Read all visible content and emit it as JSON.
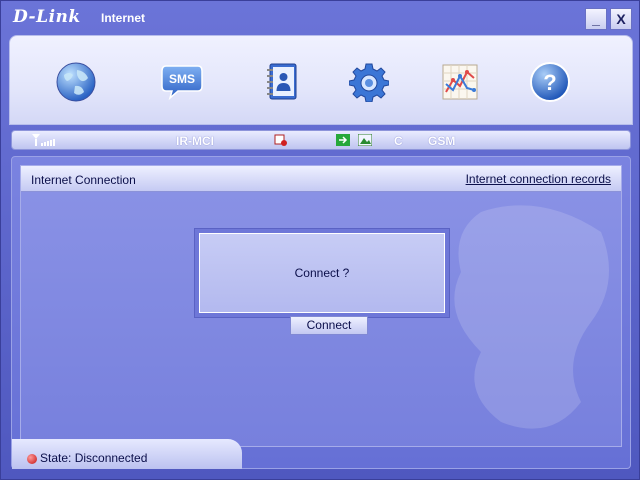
{
  "window": {
    "brand": "D-Link",
    "title": "Internet",
    "minimize_label": "_",
    "close_label": "X"
  },
  "toolbar": {
    "items": [
      {
        "name": "internet",
        "icon": "globe-icon"
      },
      {
        "name": "sms",
        "icon": "sms-bubble-icon",
        "label": "SMS"
      },
      {
        "name": "phonebook",
        "icon": "phonebook-icon"
      },
      {
        "name": "settings",
        "icon": "gear-icon"
      },
      {
        "name": "statistics",
        "icon": "line-chart-icon"
      },
      {
        "name": "help",
        "icon": "help-icon",
        "label": "?"
      }
    ]
  },
  "status_strip": {
    "operator": "IR-MCI",
    "mode_letter": "C",
    "network": "GSM"
  },
  "panel": {
    "title": "Internet Connection",
    "records_link": "Internet connection records",
    "prompt": "Connect ?",
    "connect_button": "Connect"
  },
  "status": {
    "state_text": "State: Disconnected",
    "state_color": "#c41010"
  },
  "colors": {
    "accent": "#5a64c8",
    "toolbar_bg": "#e3e6fb",
    "text": "#0b0f4a"
  }
}
